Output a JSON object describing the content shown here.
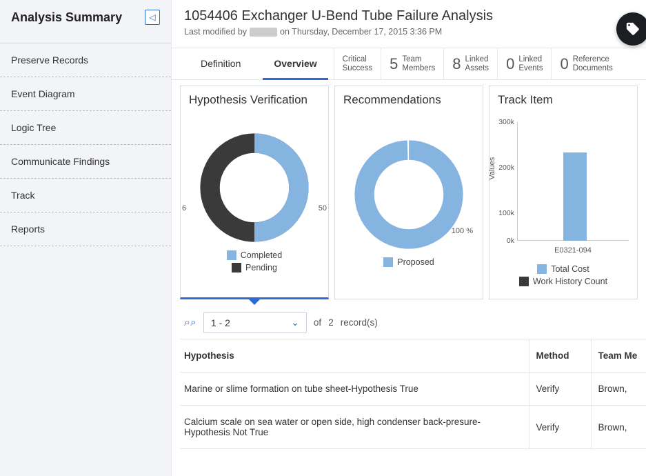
{
  "sidebar": {
    "title": "Analysis Summary",
    "items": [
      {
        "label": "Preserve Records"
      },
      {
        "label": "Event Diagram"
      },
      {
        "label": "Logic Tree"
      },
      {
        "label": "Communicate Findings"
      },
      {
        "label": "Track"
      },
      {
        "label": "Reports"
      }
    ]
  },
  "header": {
    "title": "1054406 Exchanger U-Bend Tube Failure Analysis",
    "modified_prefix": "Last modified by",
    "modified_suffix": "on Thursday, December 17, 2015 3:36 PM"
  },
  "tabs": {
    "definition": "Definition",
    "overview": "Overview"
  },
  "stats": {
    "critical_success": {
      "label": "Critical\nSuccess"
    },
    "team_members": {
      "value": "5",
      "label": "Team\nMembers"
    },
    "linked_assets": {
      "value": "8",
      "label": "Linked\nAssets"
    },
    "linked_events": {
      "value": "0",
      "label": "Linked\nEvents"
    },
    "ref_docs": {
      "value": "0",
      "label": "Reference\nDocuments"
    }
  },
  "cards": {
    "hypothesis": {
      "title": "Hypothesis Verification",
      "left_value": "6",
      "right_value": "50",
      "legend_completed": "Completed",
      "legend_pending": "Pending"
    },
    "recommendations": {
      "title": "Recommendations",
      "percent_label": "100 %",
      "legend_proposed": "Proposed"
    },
    "track": {
      "title": "Track Item",
      "legend_total_cost": "Total Cost",
      "legend_wh_count": "Work History Count"
    }
  },
  "records": {
    "page_label": "1 - 2",
    "of_text": "of",
    "count": "2",
    "records_text": "record(s)"
  },
  "table": {
    "headers": {
      "hypothesis": "Hypothesis",
      "method": "Method",
      "team": "Team Me"
    },
    "rows": [
      {
        "hypothesis": "Marine or slime formation on tube sheet-Hypothesis True",
        "method": "Verify",
        "team": "Brown,"
      },
      {
        "hypothesis": "Calcium scale on sea water or open side, high condenser back-presure-Hypothesis Not True",
        "method": "Verify",
        "team": "Brown,"
      }
    ]
  },
  "chart_data": [
    {
      "id": "hypothesis_verification",
      "type": "pie",
      "title": "Hypothesis Verification",
      "series": [
        {
          "name": "Completed",
          "value": 50,
          "color": "#85b4e0"
        },
        {
          "name": "Pending",
          "value": 50,
          "color": "#3a3a3a"
        }
      ],
      "annotations": {
        "left_label": "6",
        "right_label": "50"
      }
    },
    {
      "id": "recommendations",
      "type": "pie",
      "title": "Recommendations",
      "series": [
        {
          "name": "Proposed",
          "value": 100,
          "color": "#85b4e0"
        }
      ],
      "annotations": {
        "percent_label": "100 %"
      }
    },
    {
      "id": "track_item",
      "type": "bar",
      "title": "Track Item",
      "ylabel": "Values",
      "ylim": [
        0,
        300000
      ],
      "y_ticks": [
        0,
        100000,
        200000,
        300000
      ],
      "y_tick_labels": [
        "0k",
        "100k",
        "200k",
        "300k"
      ],
      "categories": [
        "E0321-094"
      ],
      "series": [
        {
          "name": "Total Cost",
          "values": [
            225000
          ],
          "color": "#85b4e0"
        },
        {
          "name": "Work History Count",
          "values": [
            null
          ],
          "color": "#3a3a3a"
        }
      ]
    }
  ]
}
